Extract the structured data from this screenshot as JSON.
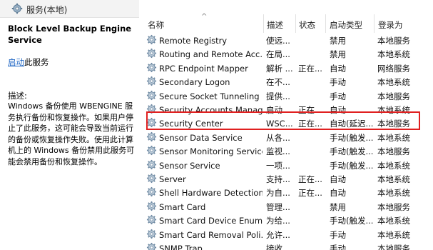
{
  "window": {
    "title": "服务(本地)"
  },
  "detail": {
    "service_title": "Block Level Backup Engine Service",
    "start_link": "启动",
    "start_suffix": "此服务",
    "desc_label": "描述:",
    "desc_text": "Windows 备份使用 WBENGINE 服务执行备份和恢复操作。如果用户停止了此服务，这可能会导致当前运行的备份或恢复操作失败。使用此计算机上的 Windows 备份禁用此服务可能会禁用备份和恢复操作。"
  },
  "table": {
    "columns": [
      "名称",
      "描述",
      "状态",
      "启动类型",
      "登录为"
    ],
    "sort_indicator": "^",
    "rows": [
      {
        "name": "Remote Registry",
        "desc": "使远...",
        "state": "",
        "start": "禁用",
        "logon": "本地服务"
      },
      {
        "name": "Routing and Remote Acc...",
        "desc": "在局...",
        "state": "",
        "start": "禁用",
        "logon": "本地系统"
      },
      {
        "name": "RPC Endpoint Mapper",
        "desc": "解析 ...",
        "state": "正在...",
        "start": "自动",
        "logon": "网络服务"
      },
      {
        "name": "Secondary Logon",
        "desc": "在不...",
        "state": "",
        "start": "手动",
        "logon": "本地系统"
      },
      {
        "name": "Secure Socket Tunneling ...",
        "desc": "提供...",
        "state": "",
        "start": "手动",
        "logon": "本地服务"
      },
      {
        "name": "Security Accounts Manag...",
        "desc": "启动...",
        "state": "正在...",
        "start": "自动",
        "logon": "本地系统"
      },
      {
        "name": "Security Center",
        "desc": "WSC...",
        "state": "正在...",
        "start": "自动(延迟...",
        "logon": "本地服务"
      },
      {
        "name": "Sensor Data Service",
        "desc": "从各...",
        "state": "",
        "start": "手动(触发...",
        "logon": "本地系统"
      },
      {
        "name": "Sensor Monitoring Service",
        "desc": "监视...",
        "state": "",
        "start": "手动(触发...",
        "logon": "本地服务"
      },
      {
        "name": "Sensor Service",
        "desc": "一项...",
        "state": "",
        "start": "手动(触发...",
        "logon": "本地系统"
      },
      {
        "name": "Server",
        "desc": "支持...",
        "state": "正在...",
        "start": "自动",
        "logon": "本地系统"
      },
      {
        "name": "Shell Hardware Detection",
        "desc": "为自...",
        "state": "正在...",
        "start": "自动",
        "logon": "本地系统"
      },
      {
        "name": "Smart Card",
        "desc": "管理...",
        "state": "",
        "start": "禁用",
        "logon": "本地服务"
      },
      {
        "name": "Smart Card Device Enum...",
        "desc": "为给...",
        "state": "",
        "start": "手动(触发...",
        "logon": "本地系统"
      },
      {
        "name": "Smart Card Removal Poli...",
        "desc": "允许...",
        "state": "",
        "start": "手动",
        "logon": "本地系统"
      },
      {
        "name": "SNMP Trap",
        "desc": "接收...",
        "state": "",
        "start": "手动",
        "logon": "本地服务"
      }
    ]
  },
  "highlight_color": "#e02020",
  "link_color": "#1f66c4"
}
